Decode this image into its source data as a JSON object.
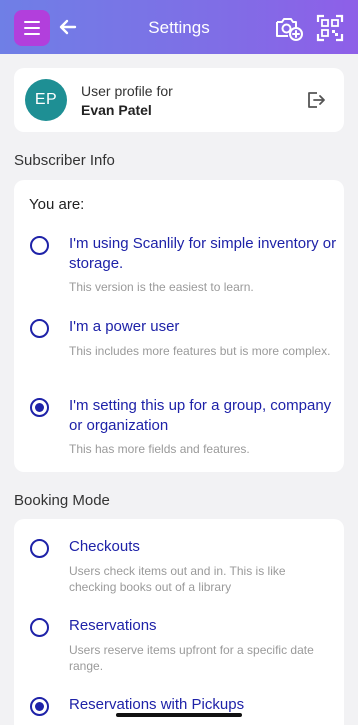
{
  "header": {
    "title": "Settings",
    "menu_icon": "hamburger-menu-icon",
    "back_icon": "back-arrow-icon",
    "camera_icon": "camera-add-icon",
    "scan_icon": "qr-scan-icon",
    "gradient_colors": [
      "#6f7fe6",
      "#8e5fe8"
    ],
    "menu_button_color": "#b23fdc"
  },
  "profile": {
    "initials": "EP",
    "label": "User profile for",
    "name": "Evan Patel",
    "avatar_color": "#1e8f94",
    "logout_icon": "logout-icon"
  },
  "subscriber": {
    "section_title": "Subscriber Info",
    "prompt": "You are:",
    "options": [
      {
        "title": "I'm using Scanlily for simple inventory or storage.",
        "description": "This version is the easiest to learn.",
        "selected": false
      },
      {
        "title": "I'm a power user",
        "description": "This includes more features but is more complex.",
        "selected": false
      },
      {
        "title": "I'm setting this up for a group, company or organization",
        "description": "This has more fields and features.",
        "selected": true
      }
    ]
  },
  "booking": {
    "section_title": "Booking Mode",
    "options": [
      {
        "title": "Checkouts",
        "description": "Users check items out and in. This is like checking books out of a library",
        "selected": false
      },
      {
        "title": "Reservations",
        "description": "Users reserve items upfront for a specific date range.",
        "selected": false
      },
      {
        "title": "Reservations with Pickups",
        "description": "",
        "selected": true
      }
    ]
  },
  "accent_color": "#1e22a8"
}
